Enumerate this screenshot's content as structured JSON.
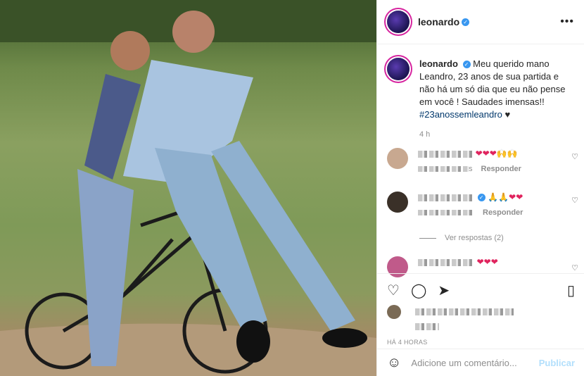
{
  "post": {
    "username": "leonardo",
    "verified_mark": "✓",
    "more_icon": "more-options-icon",
    "caption_text": "Meu querido mano Leandro, 23 anos de sua partida e não há um só dia que eu não pense em você ! Saudades imensas!!",
    "hashtag": "#23anossemleandro",
    "caption_heart": "♥",
    "time": "4 h"
  },
  "comments": [
    {
      "emojis": "❤❤❤🙌🙌",
      "meta_suffix": "s",
      "reply_label": "Responder",
      "like_icon": "♡"
    },
    {
      "emojis": "🙏🙏❤❤",
      "reply_label": "Responder",
      "like_icon": "♡"
    },
    {
      "emojis": "❤❤❤",
      "like_icon": "♡"
    }
  ],
  "view_replies": "Ver respostas (2)",
  "actions": {
    "like_icon": "heart-outline-icon",
    "comment_icon": "comment-icon",
    "share_icon": "share-icon",
    "save_icon": "bookmark-icon"
  },
  "time_ago": "HÁ 4 HORAS",
  "add_comment": {
    "emoji_icon": "☺",
    "placeholder": "Adicione um comentário...",
    "publish_label": "Publicar"
  },
  "colors": {
    "link": "#00376b",
    "verified": "#3897f0",
    "publish": "#b2dffc",
    "heart": "#e0245e"
  }
}
